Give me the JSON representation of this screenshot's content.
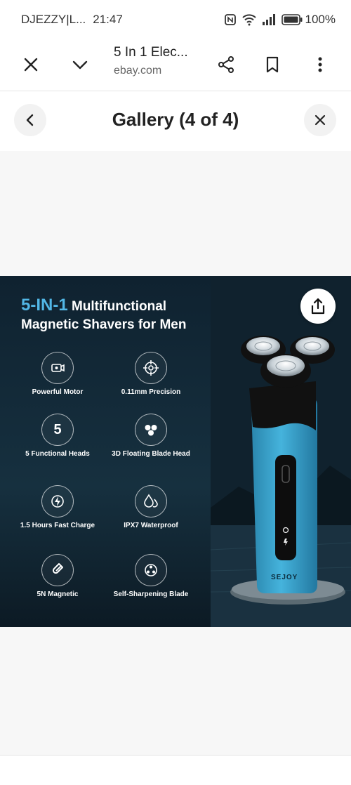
{
  "status_bar": {
    "carrier": "DJEZZY|L...",
    "time": "21:47",
    "battery": "100%"
  },
  "browser": {
    "title": "5 In 1 Elec...",
    "domain": "ebay.com"
  },
  "gallery": {
    "title": "Gallery (4 of 4)"
  },
  "product_image": {
    "headline_accent": "5-IN-1",
    "headline_rest": "Multifunctional",
    "headline_line2": "Magnetic Shavers for Men",
    "brand": "SEJOY",
    "features": [
      {
        "label": "Powerful Motor",
        "icon": "motor-icon"
      },
      {
        "label": "0.11mm Precision",
        "icon": "precision-icon"
      },
      {
        "label": "5 Functional Heads",
        "icon": "five-icon",
        "icon_text": "5"
      },
      {
        "label": "3D Floating Blade Head",
        "icon": "blade-head-icon"
      },
      {
        "label": "1.5 Hours Fast Charge",
        "icon": "charge-icon"
      },
      {
        "label": "IPX7 Waterproof",
        "icon": "waterproof-icon"
      },
      {
        "label": "5N Magnetic",
        "icon": "magnet-icon"
      },
      {
        "label": "Self-Sharpening Blade",
        "icon": "sharpening-icon"
      }
    ]
  },
  "colors": {
    "accent_blue": "#52b7e6",
    "image_bg": "#132837",
    "shaver_body": "#3aa0c8"
  }
}
